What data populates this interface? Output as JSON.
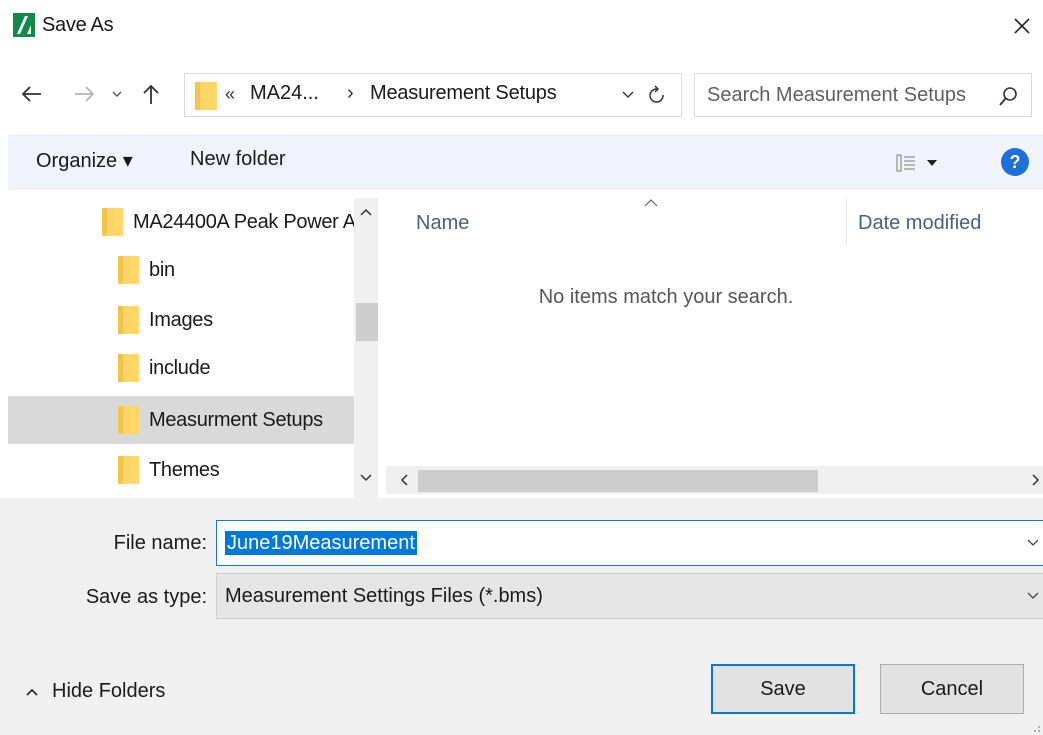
{
  "window": {
    "title": "Save As",
    "logo_icon": "anritsu-logo-icon",
    "close_icon": "close-icon"
  },
  "nav": {
    "back_icon": "arrow-left-icon",
    "forward_icon": "arrow-right-icon",
    "recent_icon": "chevron-down-icon",
    "up_icon": "arrow-up-icon"
  },
  "address": {
    "overflow": "«",
    "crumbs": [
      "MA24...",
      "Measurement Setups"
    ],
    "separator": "›",
    "refresh_icon": "refresh-icon",
    "dropdown_icon": "chevron-down-icon"
  },
  "search": {
    "placeholder": "Search Measurement Setups",
    "icon": "search-icon"
  },
  "toolbar": {
    "organize": "Organize ▾",
    "new_folder": "New folder",
    "view_icon": "view-options-icon",
    "help": "?"
  },
  "tree": {
    "items": [
      {
        "label": "MA24400A Peak Power A",
        "selected": false
      },
      {
        "label": "bin",
        "selected": false
      },
      {
        "label": "Images",
        "selected": false
      },
      {
        "label": "include",
        "selected": false
      },
      {
        "label": "Measurment Setups",
        "selected": true
      },
      {
        "label": "Themes",
        "selected": false
      }
    ]
  },
  "file_list": {
    "columns": [
      "Name",
      "Date modified"
    ],
    "empty_message": "No items match your search."
  },
  "form": {
    "file_name_label": "File name:",
    "file_name_value": "June19Measurement",
    "save_type_label": "Save as type:",
    "save_type_value": "Measurement Settings Files (*.bms)"
  },
  "footer": {
    "hide_folders": "Hide Folders",
    "save": "Save",
    "cancel": "Cancel"
  },
  "colors": {
    "accent": "#0078d7",
    "folder": "#ffd766",
    "selected_row": "#d9d9d9",
    "toolbar_bg": "#f0f4f9"
  }
}
